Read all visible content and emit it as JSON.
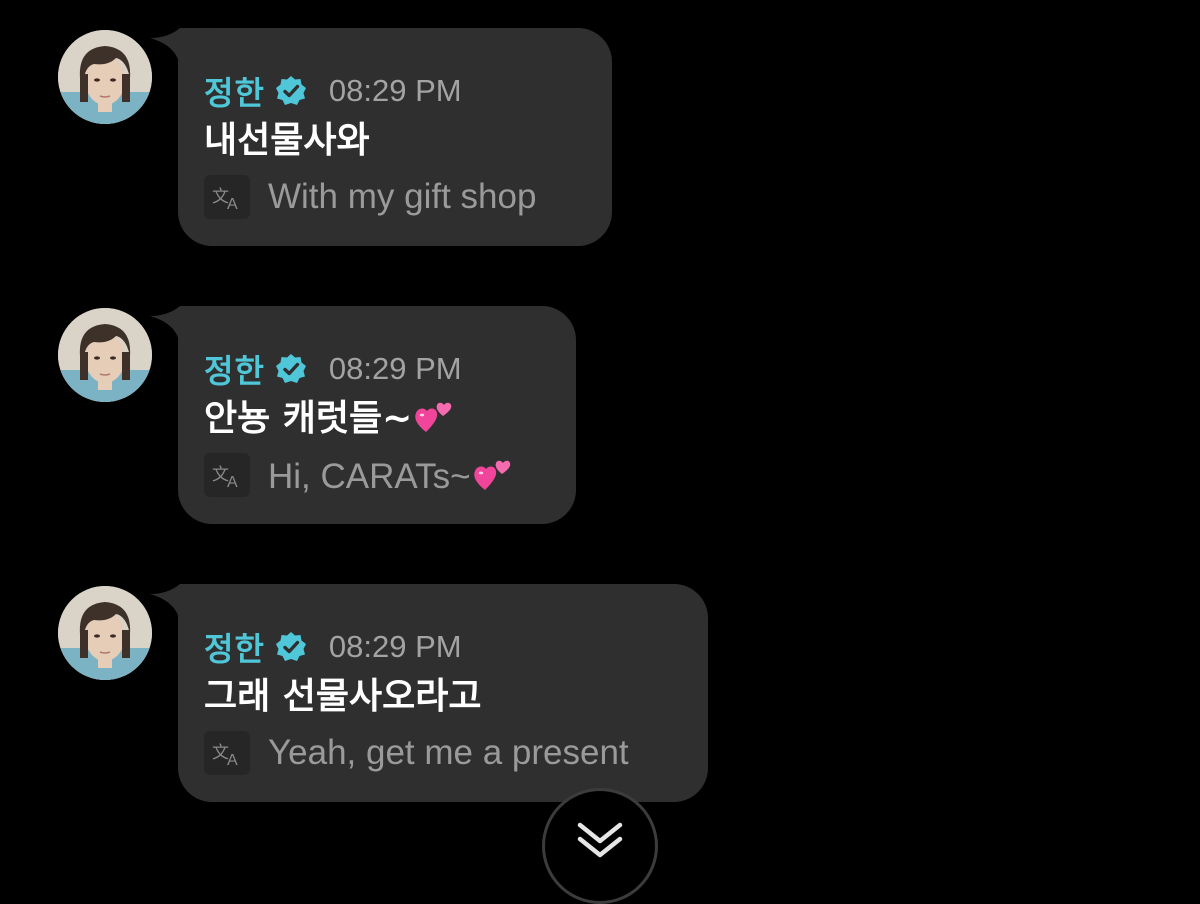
{
  "messages": [
    {
      "sender": "정한",
      "time": "08:29 PM",
      "text": "내선물사와",
      "translation": "With my gift shop",
      "emoji": ""
    },
    {
      "sender": "정한",
      "time": "08:29 PM",
      "text": "안뇽 캐럿들~",
      "translation": "Hi, CARATs~",
      "emoji": "two-hearts"
    },
    {
      "sender": "정한",
      "time": "08:29 PM",
      "text": "그래 선물사오라고",
      "translation": "Yeah, get me a present",
      "emoji": ""
    }
  ],
  "icons": {
    "verified": "verified-badge-icon",
    "translate": "translate-icon",
    "scroll_down": "double-chevron-down-icon",
    "heart_emoji": "two-hearts-emoji"
  },
  "colors": {
    "background": "#000000",
    "bubble": "#2f2f2f",
    "sender_name": "#4fc7d8",
    "verified_badge": "#4fc7d8",
    "timestamp": "#a3a3a3",
    "message_text": "#ffffff",
    "translation_text": "#9a9a9a",
    "heart_emoji": "#f0459a"
  }
}
